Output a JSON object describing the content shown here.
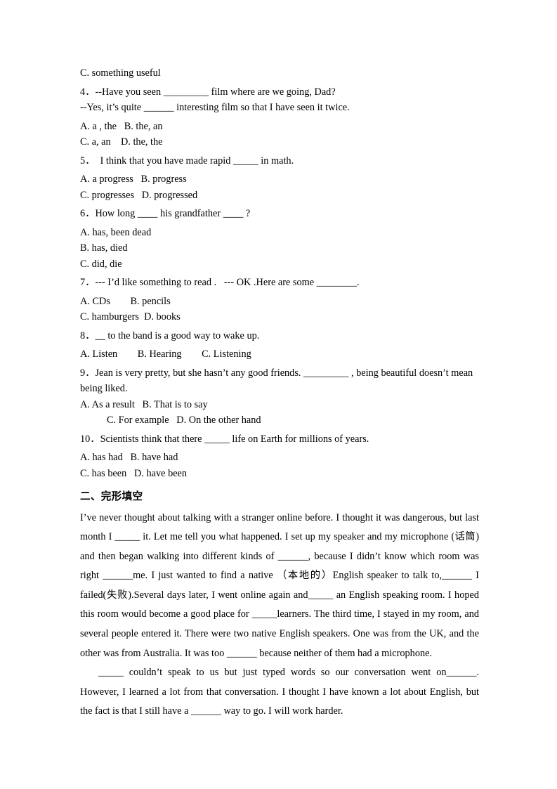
{
  "document": {
    "type": "english-exam-worksheet",
    "page_background": "#ffffff",
    "text_color": "#000000"
  },
  "multiple_choice": {
    "orphan_option": "C. something useful",
    "questions": [
      {
        "number": "4",
        "stem": "4．--Have you seen _________ film where are we going, Dad?",
        "stem_second_line": "--Yes, it’s quite ______ interesting film so that I have seen it twice.",
        "option_lines": [
          "A. a , the   B. the, an",
          "C. a, an    D. the, the"
        ]
      },
      {
        "number": "5",
        "stem": "5．  I think that you have made rapid _____ in math.",
        "option_lines": [
          "A. a progress   B. progress",
          "C. progresses   D. progressed"
        ]
      },
      {
        "number": "6",
        "stem": "6．How long ____ his grandfather ____ ?",
        "option_lines": [
          "A. has, been dead",
          "B. has, died",
          "C. did, die"
        ]
      },
      {
        "number": "7",
        "stem": "7．--- I’d like something to read .   --- OK .Here are some ________.",
        "option_lines": [
          "A. CDs        B. pencils",
          "C. hamburgers  D. books"
        ]
      },
      {
        "number": "8",
        "stem": "8．__ to the band is a good way to wake up.",
        "option_lines": [
          "A. Listen        B. Hearing        C. Listening"
        ]
      },
      {
        "number": "9",
        "stem": "9．Jean is very pretty, but she hasn’t any good friends. _________ , being beautiful doesn’t mean",
        "stem_wrap": "being liked.",
        "option_lines": [
          "A. As a result   B. That is to say",
          "C. For example   D. On the other hand"
        ],
        "second_option_indented": true
      },
      {
        "number": "10",
        "stem": "10．Scientists think that there _____ life on Earth for millions of years.",
        "option_lines": [
          "A. has had   B. have had",
          "C. has been   D. have been"
        ]
      }
    ]
  },
  "cloze_section": {
    "heading": "二、完形填空",
    "paragraph_1": "I’ve never thought about talking with a stranger online before. I thought it was dangerous, but last month I _____ it. Let me tell you what happened. I set up my speaker and my microphone (话筒) and then began walking into different kinds of ______, because I didn’t know which room was right ______me. I just wanted to find a native （本地的）English speaker to talk to,______ I failed(失败).Several days later, I went online again and_____ an English speaking room. I hoped this room would become a good place for _____learners. The third time, I stayed in my room, and several people entered it. There were two native English speakers. One was from the UK, and the other was from Australia. It was too ______ because neither of them had a microphone.",
    "paragraph_2": "_____ couldn’t speak to us but just typed words so our conversation went on______. However, I learned a lot from that conversation. I thought I have known a lot about English, but the fact is that I still have a ______ way to go. I will work harder."
  }
}
